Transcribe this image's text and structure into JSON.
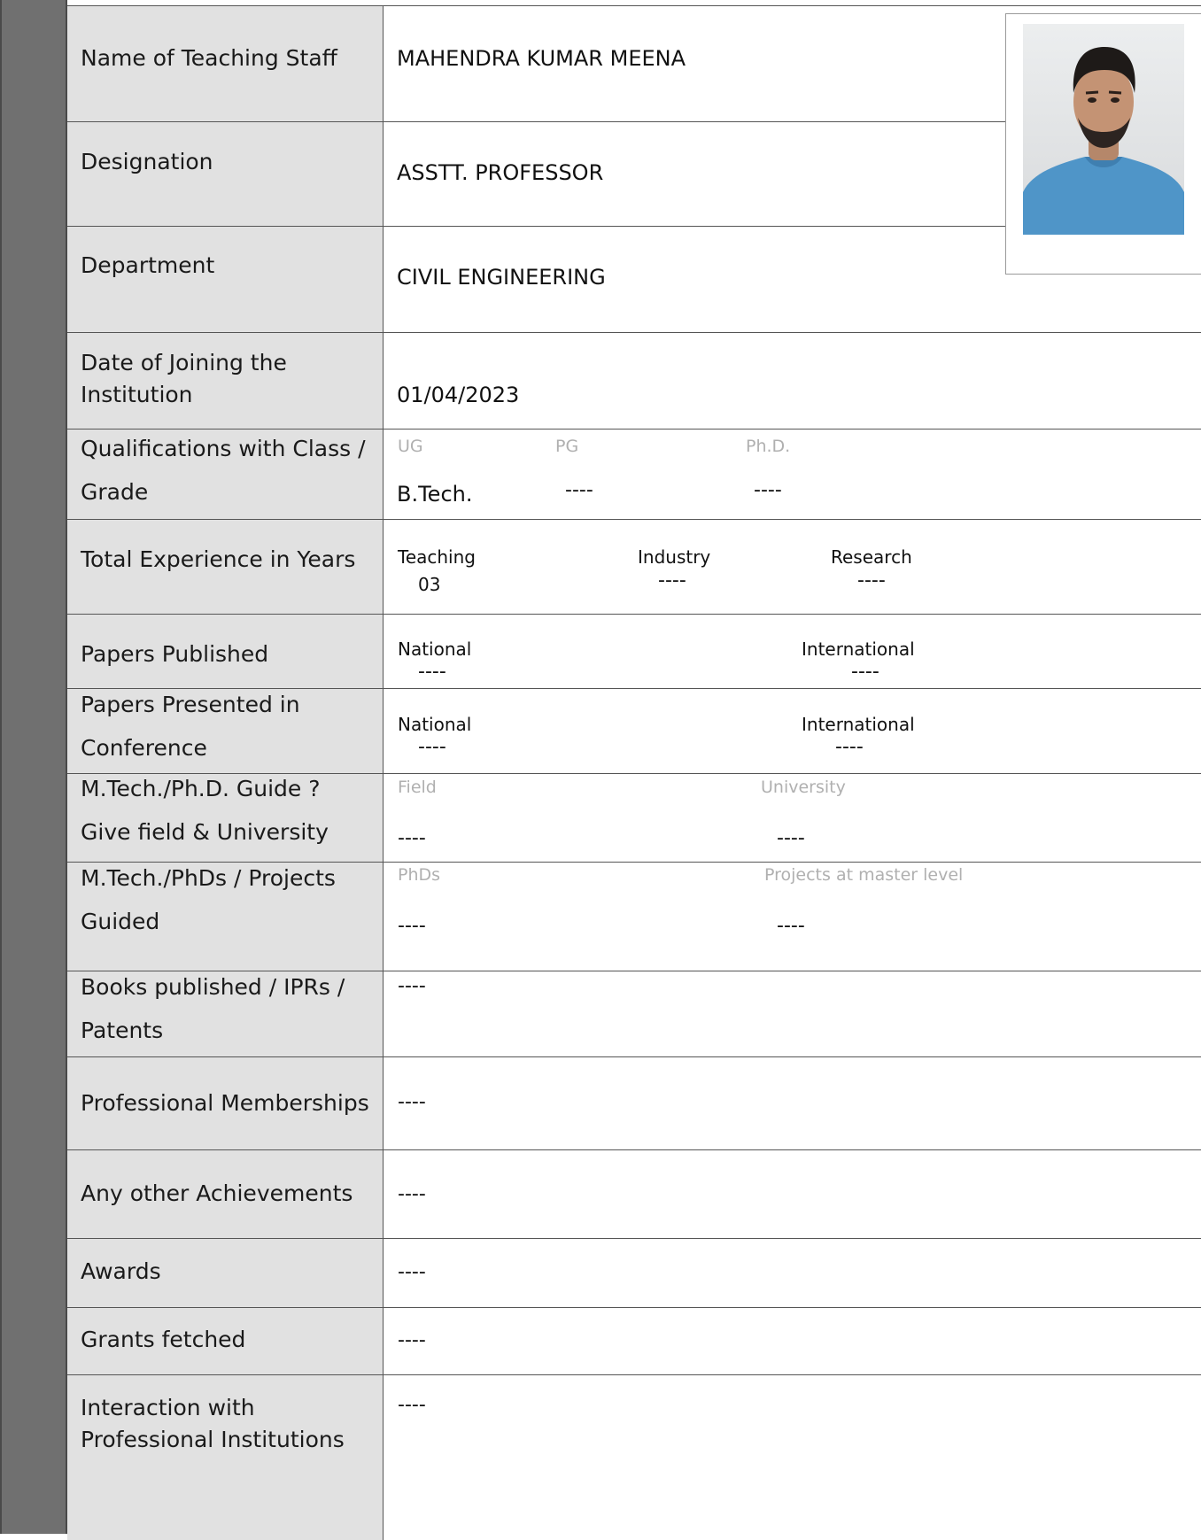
{
  "profile": {
    "name_label": "Name of Teaching Staff",
    "name": "MAHENDRA KUMAR MEENA",
    "designation_label": "Designation",
    "designation": "ASSTT. PROFESSOR",
    "department_label": "Department",
    "department": "CIVIL ENGINEERING",
    "joining_label": "Date of Joining the Institution",
    "joining_date": "01/04/2023"
  },
  "qualifications": {
    "label": "Qualifications with Class / Grade",
    "ug_head": "UG",
    "pg_head": "PG",
    "phd_head": "Ph.D.",
    "ug": "B.Tech.",
    "pg": "----",
    "phd": "----"
  },
  "experience": {
    "label": "Total Experience in Years",
    "teaching_head": "Teaching",
    "industry_head": "Industry",
    "research_head": "Research",
    "teaching": "03",
    "industry": "----",
    "research": "----"
  },
  "papers_published": {
    "label": "Papers Published",
    "national_head": "National",
    "international_head": "International",
    "national": "----",
    "international": "----"
  },
  "papers_presented": {
    "label": "Papers Presented in Conference",
    "national_head": "National",
    "international_head": "International",
    "national": "----",
    "international": "----"
  },
  "guide": {
    "label": "M.Tech./Ph.D. Guide ? Give field & University",
    "field_head": "Field",
    "university_head": "University",
    "field": "----",
    "university": "----"
  },
  "guided": {
    "label": "M.Tech./PhDs / Projects Guided",
    "phds_head": "PhDs",
    "projects_head": "Projects at master level",
    "phds": "----",
    "projects": "----"
  },
  "books": {
    "label": "Books published / IPRs / Patents",
    "value": "----"
  },
  "memberships": {
    "label": "Professional Memberships",
    "value": "----"
  },
  "achievements": {
    "label": "Any other Achievements",
    "value": "----"
  },
  "awards": {
    "label": "Awards",
    "value": "----"
  },
  "grants": {
    "label": "Grants fetched",
    "value": "----"
  },
  "interaction": {
    "label": "Interaction with Professional Institutions",
    "value": "----"
  },
  "photo": {
    "icon": "person-photo"
  }
}
